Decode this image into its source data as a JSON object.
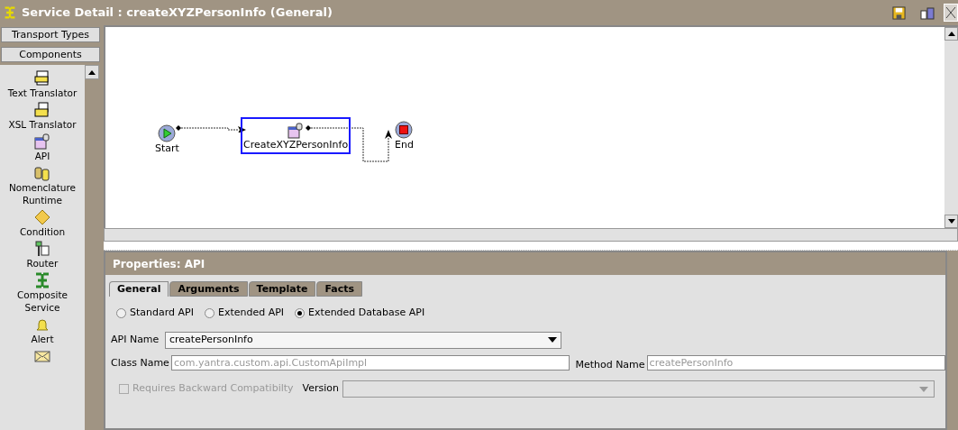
{
  "window": {
    "title": "Service Detail : createXYZPersonInfo (General)"
  },
  "sidebar": {
    "sections": [
      "Transport Types",
      "Components"
    ],
    "components": [
      {
        "kind": "text",
        "label": "Text Translator"
      },
      {
        "kind": "xsl",
        "label": "XSL Translator"
      },
      {
        "kind": "api",
        "label": "API"
      },
      {
        "kind": "nomenclature",
        "label": "Nomenclature Runtime"
      },
      {
        "kind": "condition",
        "label": "Condition"
      },
      {
        "kind": "router",
        "label": "Router"
      },
      {
        "kind": "composite",
        "label": "Composite Service"
      },
      {
        "kind": "alert",
        "label": "Alert"
      },
      {
        "kind": "email"
      }
    ]
  },
  "canvas": {
    "nodes": [
      {
        "kind": "start",
        "label": "Start",
        "selected": false
      },
      {
        "kind": "api",
        "label": "CreateXYZPersonInfo",
        "selected": true
      },
      {
        "kind": "end",
        "label": "End",
        "selected": false
      }
    ]
  },
  "properties": {
    "title": "Properties: API",
    "tabs": [
      {
        "label": "General",
        "selected": true
      },
      {
        "label": "Arguments",
        "selected": false
      },
      {
        "label": "Template",
        "selected": false
      },
      {
        "label": "Facts",
        "selected": false
      }
    ],
    "api_types": [
      {
        "label": "Standard API",
        "selected": false
      },
      {
        "label": "Extended API",
        "selected": false
      },
      {
        "label": "Extended Database API",
        "selected": true
      }
    ],
    "api_name": {
      "label": "API Name",
      "value": "createPersonInfo"
    },
    "class_name": {
      "label": "Class Name",
      "value": "com.yantra.custom.api.CustomApiImpl",
      "disabled": true
    },
    "method_name": {
      "label": "Method Name",
      "value": "createPersonInfo",
      "disabled": true
    },
    "backward": {
      "label": "Requires Backward Compatibilty",
      "checked": false,
      "disabled": true
    },
    "version": {
      "label": "Version"
    }
  }
}
